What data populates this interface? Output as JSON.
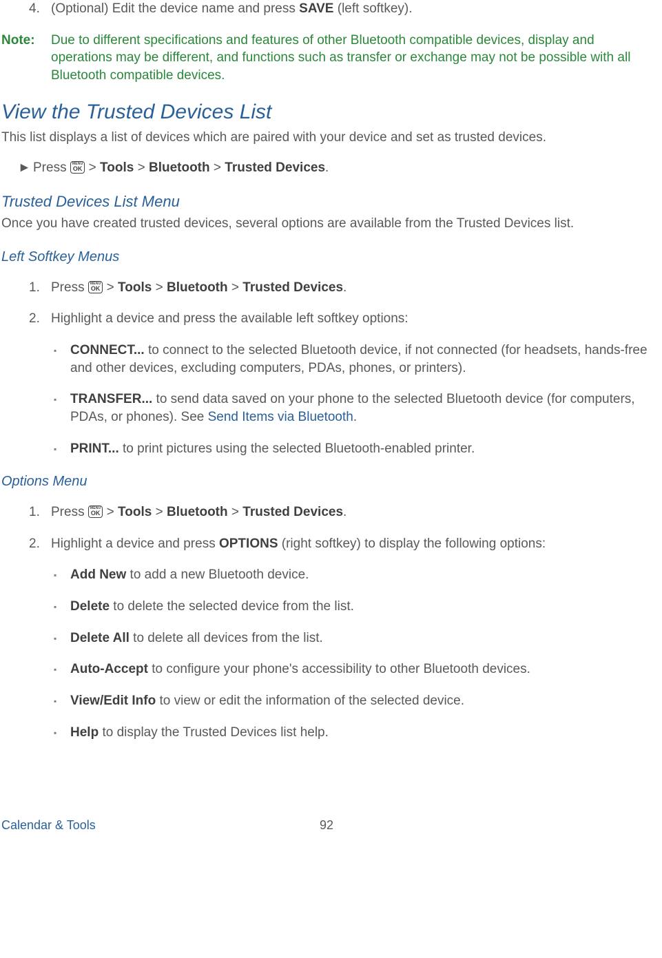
{
  "topStep": {
    "num": "4.",
    "prefix": "(Optional) Edit the device name and press ",
    "bold": "SAVE",
    "suffix": " (left softkey)."
  },
  "note": {
    "label": "Note:",
    "body": "Due to different specifications and features of other Bluetooth compatible devices, display and operations may be different, and functions such as transfer or exchange may not be possible with all Bluetooth compatible devices."
  },
  "viewHeading": "View the Trusted Devices List",
  "viewPara": "This list displays a list of devices which are paired with your device and set as trusted devices.",
  "nav": {
    "arrow": "►",
    "press": "Press ",
    "sep": " > ",
    "tools": "Tools",
    "bluetooth": "Bluetooth",
    "trusted": "Trusted Devices",
    "period": "."
  },
  "trustedMenuHeading": "Trusted Devices List Menu",
  "trustedMenuPara": "Once you have created trusted devices, several options are available from the Trusted Devices list.",
  "leftSoftkeyHeading": "Left Softkey Menus",
  "leftSteps": {
    "s1num": "1.",
    "s2num": "2.",
    "s2text": "Highlight a device and press the available left softkey options:"
  },
  "leftBullets": {
    "b1bold": "CONNECT...",
    "b1rest": " to connect to the selected Bluetooth device, if not connected (for headsets, hands-free and other devices, excluding computers, PDAs, phones, or printers).",
    "b2bold": "TRANSFER...",
    "b2rest1": " to send data saved on your phone to the selected Bluetooth device (for computers, PDAs, or phones). See ",
    "b2link": "Send Items via Bluetooth",
    "b2rest2": ".",
    "b3bold": "PRINT...",
    "b3rest": " to print pictures using the selected Bluetooth-enabled printer."
  },
  "optionsHeading": "Options Menu",
  "optSteps": {
    "s1num": "1.",
    "s2num": "2.",
    "s2prefix": "Highlight a device and press ",
    "s2bold": "OPTIONS",
    "s2suffix": " (right softkey) to display the following options:"
  },
  "optBullets": {
    "b1bold": "Add New",
    "b1rest": " to add a new Bluetooth device.",
    "b2bold": "Delete",
    "b2rest": " to delete the selected device from the list.",
    "b3bold": "Delete All",
    "b3rest": " to delete all devices from the list.",
    "b4bold": "Auto-Accept",
    "b4rest": " to configure your phone's accessibility to other Bluetooth devices.",
    "b5bold": "View/Edit Info",
    "b5rest": " to view or edit the information of the selected device.",
    "b6bold": "Help",
    "b6rest": " to display the Trusted Devices list help."
  },
  "footer": {
    "section": "Calendar & Tools",
    "page": "92"
  },
  "okKey": {
    "top": "MENU",
    "bot": "OK"
  }
}
